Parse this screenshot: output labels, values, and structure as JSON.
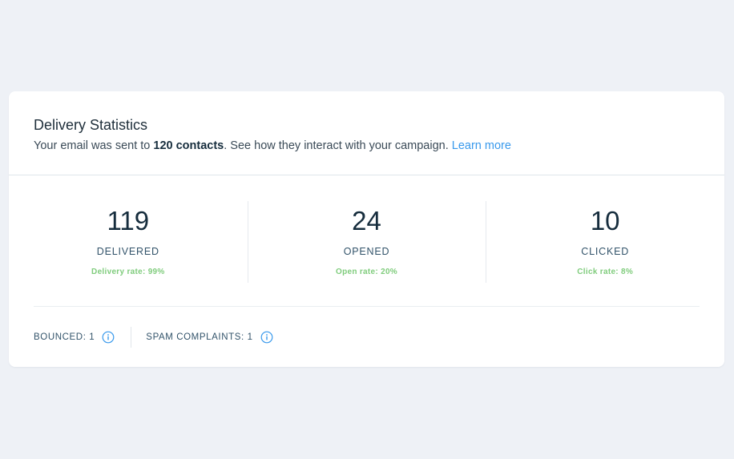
{
  "header": {
    "title": "Delivery Statistics",
    "subtitle_prefix": "Your email was sent to ",
    "contacts": "120 contacts",
    "subtitle_suffix": ". See how they interact with your campaign. ",
    "learn_more": "Learn more"
  },
  "stats": [
    {
      "value": "119",
      "label": "DELIVERED",
      "rate": "Delivery rate: 99%"
    },
    {
      "value": "24",
      "label": "OPENED",
      "rate": "Open rate: 20%"
    },
    {
      "value": "10",
      "label": "CLICKED",
      "rate": "Click rate: 8%"
    }
  ],
  "footer": {
    "bounced": "BOUNCED: 1",
    "spam": "SPAM COMPLAINTS: 1"
  },
  "colors": {
    "page_background": "#eef1f6",
    "link": "#3899ec",
    "rate_green": "#7fcc7c",
    "text_dark": "#162d3d"
  },
  "icons": {
    "info": "info-circle-icon"
  }
}
